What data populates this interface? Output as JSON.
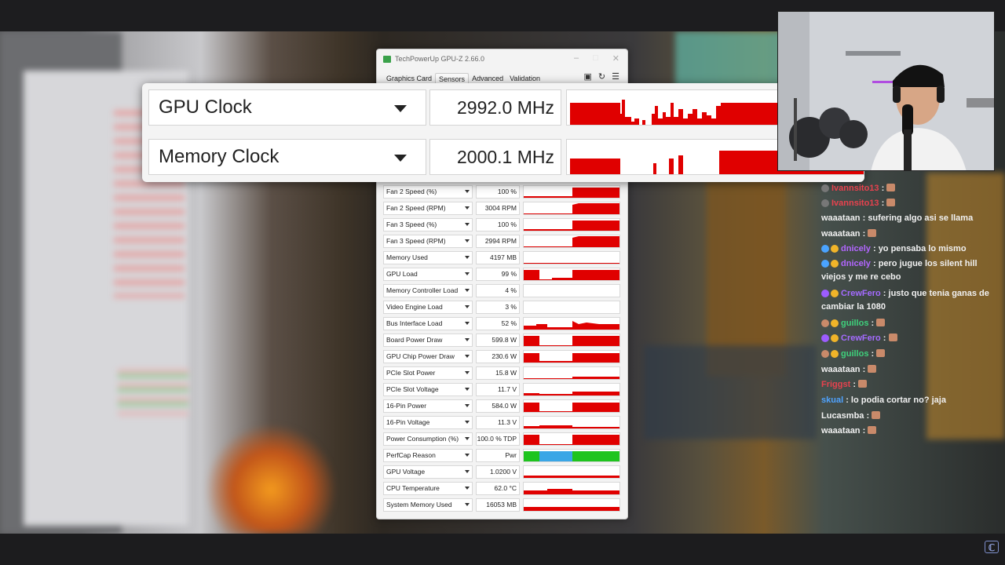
{
  "gpuz": {
    "window_title": "TechPowerUp GPU-Z 2.66.0",
    "tabs": [
      "Graphics Card",
      "Sensors",
      "Advanced",
      "Validation"
    ],
    "active_tab": "Sensors"
  },
  "zoom_rows": [
    {
      "name": "GPU Clock",
      "value": "2992.0 MHz"
    },
    {
      "name": "Memory Clock",
      "value": "2000.1 MHz"
    }
  ],
  "sensors": [
    {
      "name": "Fan 2 Speed (%)",
      "value": "100 %"
    },
    {
      "name": "Fan 2 Speed (RPM)",
      "value": "3004 RPM"
    },
    {
      "name": "Fan 3 Speed (%)",
      "value": "100 %"
    },
    {
      "name": "Fan 3 Speed (RPM)",
      "value": "2994 RPM"
    },
    {
      "name": "Memory Used",
      "value": "4197 MB"
    },
    {
      "name": "GPU Load",
      "value": "99 %"
    },
    {
      "name": "Memory Controller Load",
      "value": "4 %"
    },
    {
      "name": "Video Engine Load",
      "value": "3 %"
    },
    {
      "name": "Bus Interface Load",
      "value": "52 %"
    },
    {
      "name": "Board Power Draw",
      "value": "599.8 W"
    },
    {
      "name": "GPU Chip Power Draw",
      "value": "230.6 W"
    },
    {
      "name": "PCIe Slot Power",
      "value": "15.8 W"
    },
    {
      "name": "PCIe Slot Voltage",
      "value": "11.7 V"
    },
    {
      "name": "16-Pin Power",
      "value": "584.0 W"
    },
    {
      "name": "16-Pin Voltage",
      "value": "11.3 V"
    },
    {
      "name": "Power Consumption (%)",
      "value": "100.0 % TDP"
    },
    {
      "name": "PerfCap Reason",
      "value": "Pwr"
    },
    {
      "name": "GPU Voltage",
      "value": "1.0200 V"
    },
    {
      "name": "CPU Temperature",
      "value": "62.0 °C"
    },
    {
      "name": "System Memory Used",
      "value": "16053 MB"
    }
  ],
  "chat": [
    {
      "user": "Ivannsito13",
      "sep": " : ",
      "text": "",
      "user_color": "#e8424e"
    },
    {
      "user": "Ivannsito13",
      "sep": " : ",
      "text": "",
      "user_color": "#e8424e"
    },
    {
      "user": "waaataan",
      "sep": " : ",
      "text": "sufering algo asi se llama",
      "user_color": "#f1f1f1"
    },
    {
      "user": "waaataan",
      "sep": " : ",
      "text": "",
      "user_color": "#f1f1f1"
    },
    {
      "user": "dnicely",
      "sep": " : ",
      "text": "yo pensaba lo mismo",
      "user_color": "#b266ff"
    },
    {
      "user": "dnicely",
      "sep": " : ",
      "text": "pero jugue los silent hill viejos y me re cebo",
      "user_color": "#b266ff"
    },
    {
      "user": "CrewFero",
      "sep": " : ",
      "text": "justo que tenia ganas de cambiar la 1080",
      "user_color": "#a46bff"
    },
    {
      "user": "guillos",
      "sep": " : ",
      "text": "",
      "user_color": "#3fd17c"
    },
    {
      "user": "CrewFero",
      "sep": " : ",
      "text": "",
      "user_color": "#a46bff"
    },
    {
      "user": "guillos",
      "sep": " : ",
      "text": "",
      "user_color": "#3fd17c"
    },
    {
      "user": "waaataan",
      "sep": " : ",
      "text": "",
      "user_color": "#f1f1f1"
    },
    {
      "user": "Friggst",
      "sep": " : ",
      "text": "",
      "user_color": "#e8424e"
    },
    {
      "user": "skual",
      "sep": " : ",
      "text": "lo podia cortar no? jaja",
      "user_color": "#4fa3ff"
    },
    {
      "user": "Lucasmba",
      "sep": " : ",
      "text": "",
      "user_color": "#f1f1f1"
    },
    {
      "user": "waaataan",
      "sep": " : ",
      "text": "",
      "user_color": "#f1f1f1"
    }
  ],
  "colors": {
    "graph_red": "#e00000",
    "perfcap_green": "#1ec41e",
    "perfcap_blue": "#3aa6e6"
  },
  "icons": [
    "gpuz-logo-icon",
    "minimize-icon",
    "maximize-icon",
    "close-icon",
    "camera-icon",
    "refresh-icon",
    "menu-icon",
    "dropdown-arrow-icon",
    "channel-logo-icon"
  ]
}
